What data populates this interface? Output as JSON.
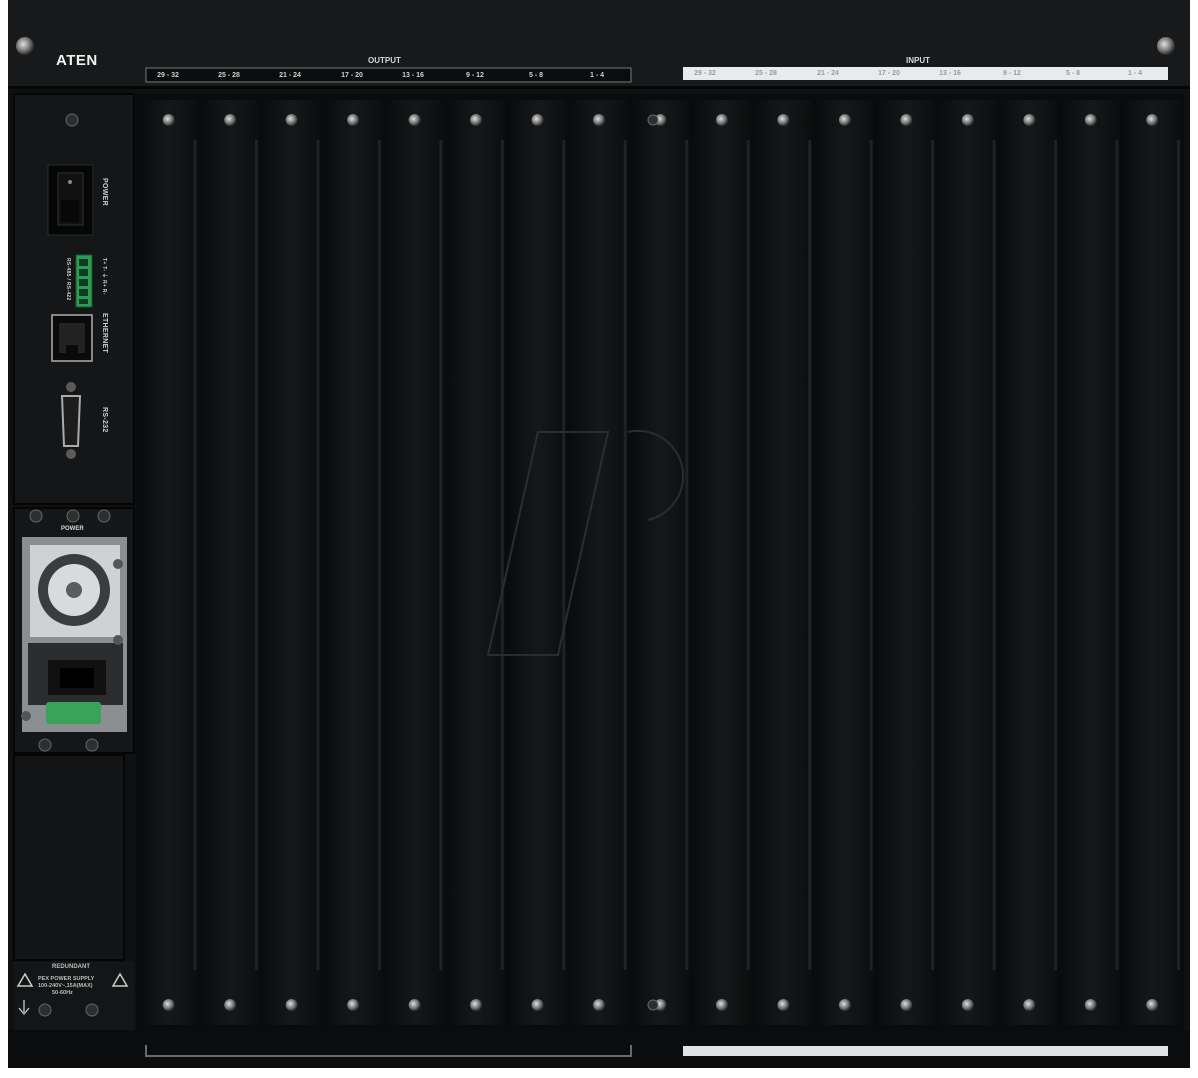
{
  "brand": "ATEN",
  "header": {
    "output_title": "OUTPUT",
    "input_title": "INPUT",
    "output_slots": [
      "29 - 32",
      "25 - 28",
      "21 - 24",
      "17 - 20",
      "13 - 16",
      "9 - 12",
      "5 - 8",
      "1 - 4"
    ],
    "input_slots": [
      "29 - 32",
      "25 - 28",
      "21 - 24",
      "17 - 20",
      "13 - 16",
      "9 - 12",
      "5 - 8",
      "1 - 4"
    ]
  },
  "control_panel": {
    "power_label": "POWER",
    "rs485_label": "RS-485 / RS-422",
    "rs485_pins": "T+ T- ⏚ R+ R-",
    "ethernet_label": "ETHERNET",
    "rs232_label": "RS-232"
  },
  "psu": {
    "power_label": "POWER",
    "redundant_label": "REDUNDANT",
    "supply_line1": "PEX POWER SUPPLY",
    "supply_line2": "100-240V~,15A(MAX)",
    "supply_line3": "50-60Hz"
  },
  "colors": {
    "chassis": "#0d0f10",
    "panel": "#141617",
    "psu_green": "#3aa35a",
    "input_bar": "#e8eaec"
  }
}
